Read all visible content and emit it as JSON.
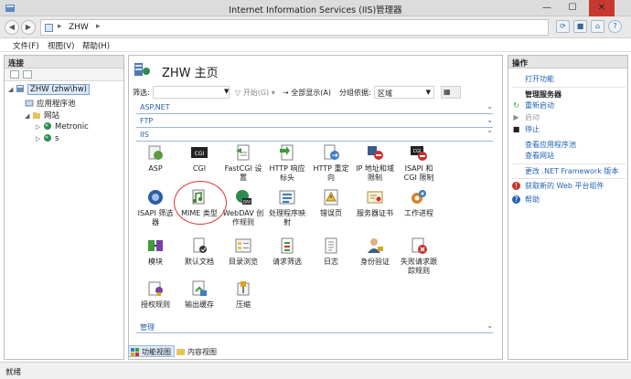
{
  "window": {
    "title": "Internet Information Services (IIS)管理器",
    "min": "—",
    "max": "☐",
    "close": "✕"
  },
  "address": {
    "crumb": "ZHW",
    "sep": "▸"
  },
  "menu": [
    "文件(F)",
    "视图(V)",
    "帮助(H)"
  ],
  "connections": {
    "title": "连接",
    "server": "ZHW (zhw\\hw)",
    "app_pools": "应用程序池",
    "sites": "网站",
    "site_1": "Metronic",
    "site_2": "s"
  },
  "center": {
    "title": "ZHW 主页",
    "filter_label": "筛选:",
    "start": "开始(G)",
    "show_all": "全部显示(A)",
    "group_label": "分组依据:",
    "group_value": "区域",
    "sections": {
      "aspnet": "ASP.NET",
      "ftp": "FTP",
      "iis": "IIS",
      "manage": "管理"
    },
    "features": [
      "ASP",
      "CGI",
      "FastCGI 设置",
      "HTTP 响应标头",
      "HTTP 重定向",
      "IP 地址和域限制",
      "ISAPI 和 CGI 限制",
      "ISAPI 筛选器",
      "MIME 类型",
      "WebDAV 创作规则",
      "处理程序映射",
      "错误页",
      "服务器证书",
      "工作进程",
      "模块",
      "默认文档",
      "目录浏览",
      "请求筛选",
      "日志",
      "身份验证",
      "失败请求跟踪规则",
      "授权规则",
      "输出缓存",
      "压缩"
    ],
    "tab_feature": "功能视图",
    "tab_content": "内容视图"
  },
  "actions": {
    "title": "操作",
    "open_feature": "打开功能",
    "manage_server": "管理服务器",
    "restart": "重新启动",
    "start": "启动",
    "stop": "停止",
    "view_app_pools": "查看应用程序池",
    "view_sites": "查看网站",
    "change_net": "更改 .NET Framework 版本",
    "get_components": "获取新的 Web 平台组件",
    "help": "帮助"
  },
  "status": "就绪",
  "colors": {
    "accent": "#2263b6",
    "highlight_circle": "#d33333",
    "close_button": "#c7392f"
  }
}
